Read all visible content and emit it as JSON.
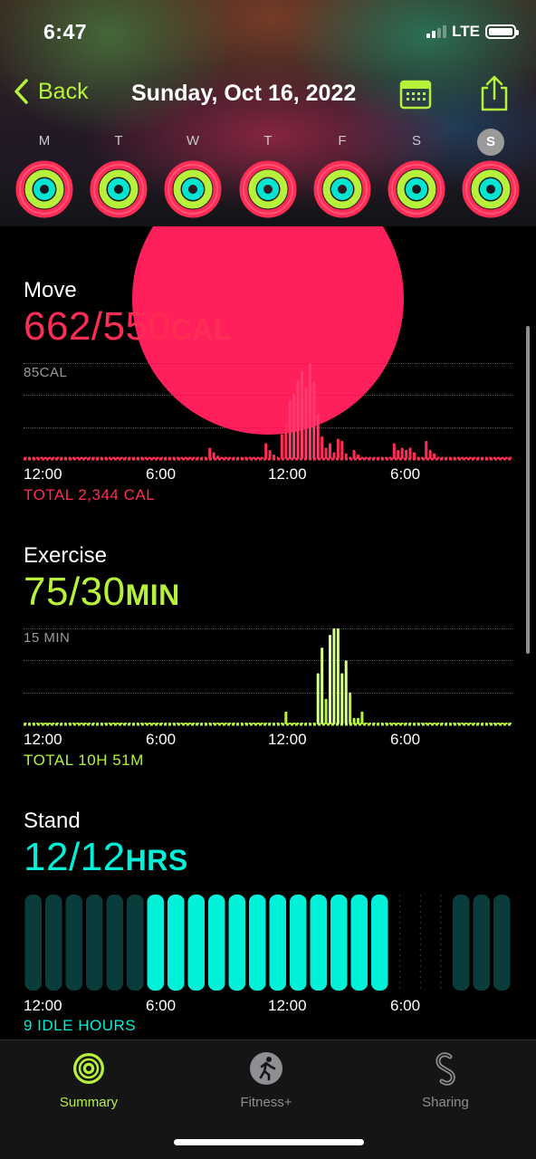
{
  "status": {
    "time": "6:47",
    "network": "LTE"
  },
  "nav": {
    "back_label": "Back",
    "title": "Sunday, Oct 16, 2022",
    "accent": "#b6f23b"
  },
  "week": {
    "days": [
      "M",
      "T",
      "W",
      "T",
      "F",
      "S",
      "S"
    ],
    "today_index": 6
  },
  "move": {
    "title": "Move",
    "value": "662/550",
    "unit": "CAL",
    "axis_max_label": "85CAL",
    "total": "TOTAL 2,344 CAL",
    "color": "#ff2d55",
    "color_bright": "#ff3b6b",
    "hourly_values": [
      2,
      2,
      2,
      2,
      2,
      2,
      2,
      2,
      2,
      2,
      2,
      2,
      2,
      2,
      2,
      2,
      2,
      2,
      2,
      2,
      2,
      2,
      2,
      2,
      2,
      2,
      2,
      2,
      2,
      2,
      2,
      2,
      2,
      2,
      2,
      2,
      2,
      2,
      2,
      2,
      2,
      2,
      2,
      2,
      2,
      2,
      10,
      6,
      3,
      2,
      2,
      2,
      2,
      2,
      2,
      2,
      2,
      2,
      2,
      2,
      14,
      8,
      4,
      2,
      22,
      32,
      52,
      58,
      70,
      78,
      64,
      85,
      68,
      40,
      20,
      10,
      14,
      6,
      18,
      16,
      5,
      2,
      8,
      4,
      2,
      2,
      2,
      2,
      2,
      2,
      2,
      2,
      14,
      8,
      10,
      8,
      10,
      6,
      2,
      2,
      16,
      8,
      5,
      2,
      2,
      2,
      2,
      2,
      2,
      2,
      2,
      2,
      2,
      2,
      2,
      2,
      2,
      2,
      2,
      2,
      2,
      2
    ]
  },
  "exercise": {
    "title": "Exercise",
    "value": "75/30",
    "unit": "MIN",
    "axis_max_label": "15 MIN",
    "total": "TOTAL 10H 51M",
    "color": "#b6f23b",
    "color_bright": "#d6ff8a",
    "hourly_values": [
      0,
      0,
      0,
      0,
      0,
      0,
      0,
      0,
      0,
      0,
      0,
      0,
      0,
      0,
      0,
      0,
      0,
      0,
      0,
      0,
      0,
      0,
      0,
      0,
      0,
      0,
      0,
      0,
      0,
      0,
      0,
      0,
      0,
      0,
      0,
      0,
      0,
      0,
      0,
      0,
      0,
      0,
      0,
      0,
      0,
      0,
      0,
      0,
      0,
      0,
      0,
      0,
      0,
      0,
      0,
      0,
      0,
      0,
      0,
      0,
      0,
      0,
      0,
      0,
      0,
      2,
      0,
      0,
      0,
      0,
      0,
      0,
      0,
      8,
      12,
      4,
      14,
      15,
      15,
      8,
      10,
      5,
      1,
      1,
      2,
      0,
      0,
      0,
      0,
      0,
      0,
      0,
      0,
      0,
      0,
      0,
      0,
      0,
      0,
      0,
      0,
      0,
      0,
      0,
      0,
      0,
      0,
      0,
      0,
      0,
      0,
      0,
      0,
      0,
      0,
      0,
      0,
      0,
      0,
      0,
      0,
      0
    ]
  },
  "stand": {
    "title": "Stand",
    "value": "12/12",
    "unit": "HRS",
    "idle": "9 IDLE HOURS",
    "color": "#00f0d8",
    "color_dim": "#0a3c3c",
    "hours": [
      0,
      0,
      0,
      0,
      0,
      0,
      1,
      1,
      1,
      1,
      1,
      1,
      1,
      1,
      1,
      1,
      1,
      1,
      -1,
      -1,
      -1,
      0,
      0,
      0
    ]
  },
  "axis_times": [
    "12:00",
    "6:00",
    "12:00",
    "6:00"
  ],
  "tabs": [
    {
      "label": "Summary",
      "active": true,
      "icon": "activity-rings-icon"
    },
    {
      "label": "Fitness+",
      "active": false,
      "icon": "fitness-plus-icon"
    },
    {
      "label": "Sharing",
      "active": false,
      "icon": "sharing-icon"
    }
  ]
}
